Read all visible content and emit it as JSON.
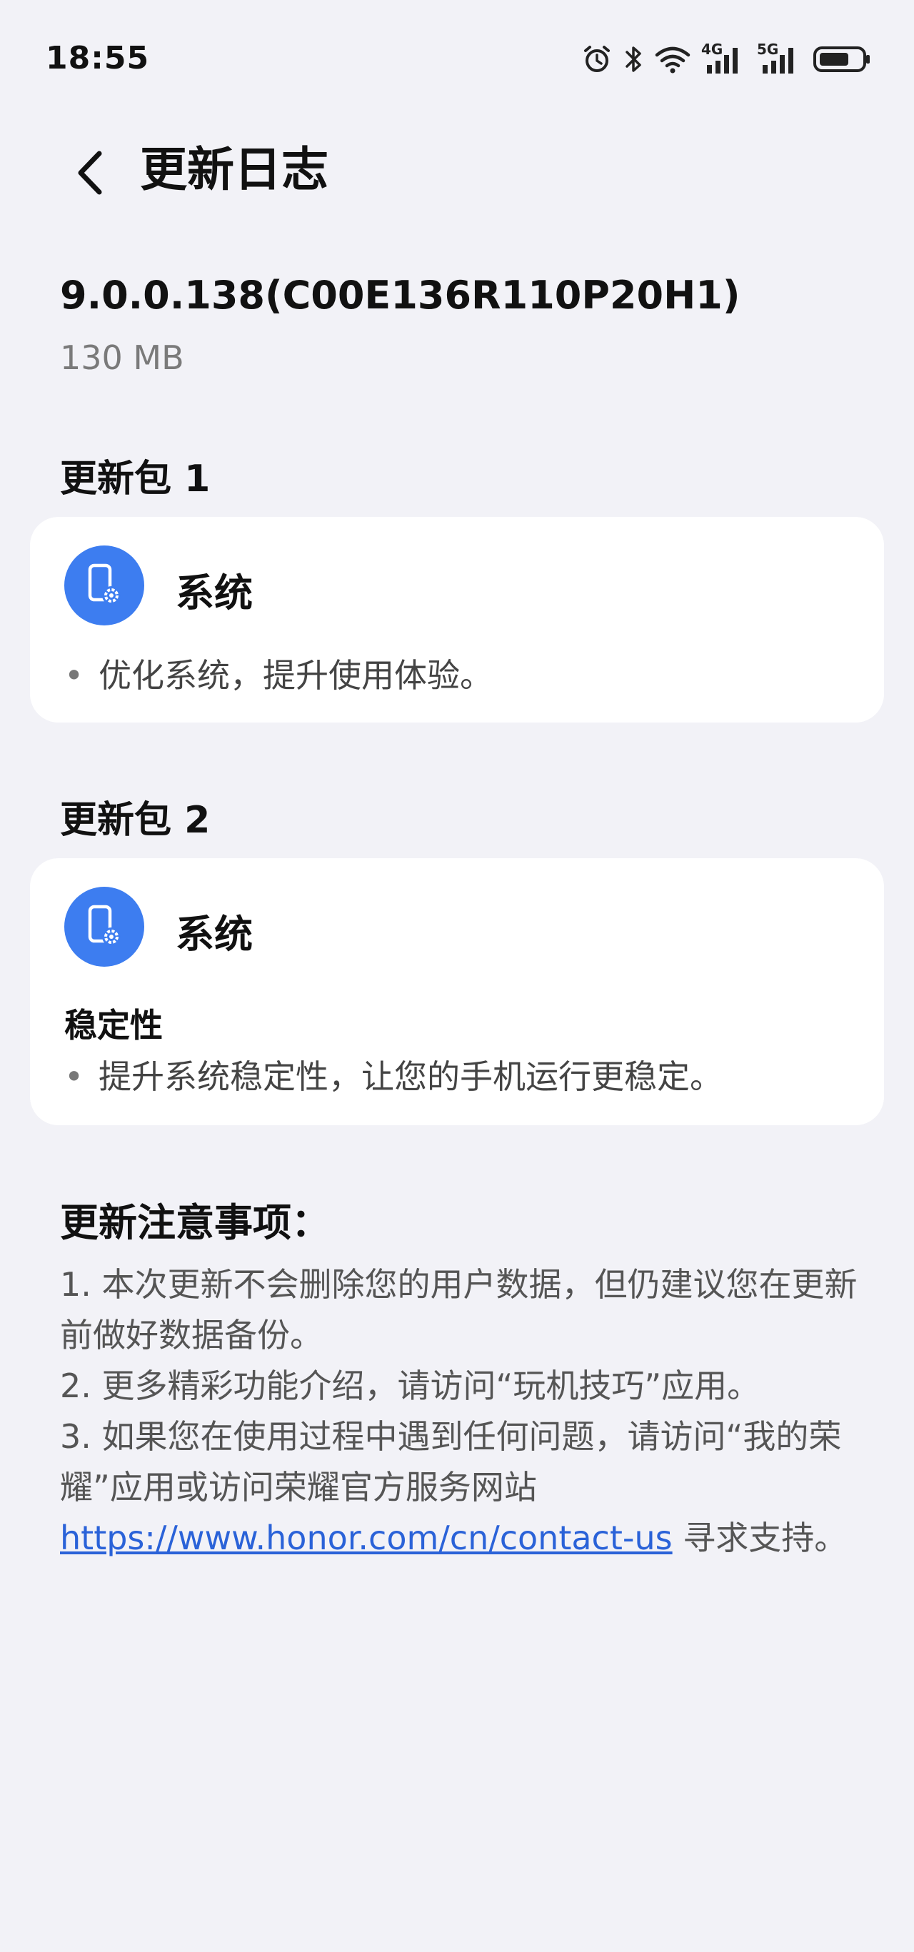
{
  "status_bar": {
    "time": "18:55",
    "network_4g": "4G",
    "network_5g": "5G"
  },
  "header": {
    "title": "更新日志"
  },
  "release": {
    "version": "9.0.0.138(C00E136R110P20H1)",
    "size": "130 MB"
  },
  "packages": [
    {
      "title": "更新包 1",
      "component": "系统",
      "icon": "phone-settings-icon",
      "bullets": [
        "优化系统，提升使用体验。"
      ]
    },
    {
      "title": "更新包 2",
      "component": "系统",
      "icon": "phone-settings-icon",
      "subheading": "稳定性",
      "bullets": [
        "提升系统稳定性，让您的手机运行更稳定。"
      ]
    }
  ],
  "notes": {
    "title": "更新注意事项：",
    "item1": "1. 本次更新不会删除您的用户数据，但仍建议您在更新前做好数据备份。",
    "item2": "2. 更多精彩功能介绍，请访问“玩机技巧”应用。",
    "item3_prefix": "3. 如果您在使用过程中遇到任何问题，请访问“我的荣耀”应用或访问荣耀官方服务网站",
    "link": "https://www.honor.com/cn/contact-us",
    "item3_suffix": " 寻求支持。"
  },
  "colors": {
    "background": "#f2f2f7",
    "card": "#ffffff",
    "icon_blue": "#3d7df0",
    "link": "#2a62d8"
  }
}
